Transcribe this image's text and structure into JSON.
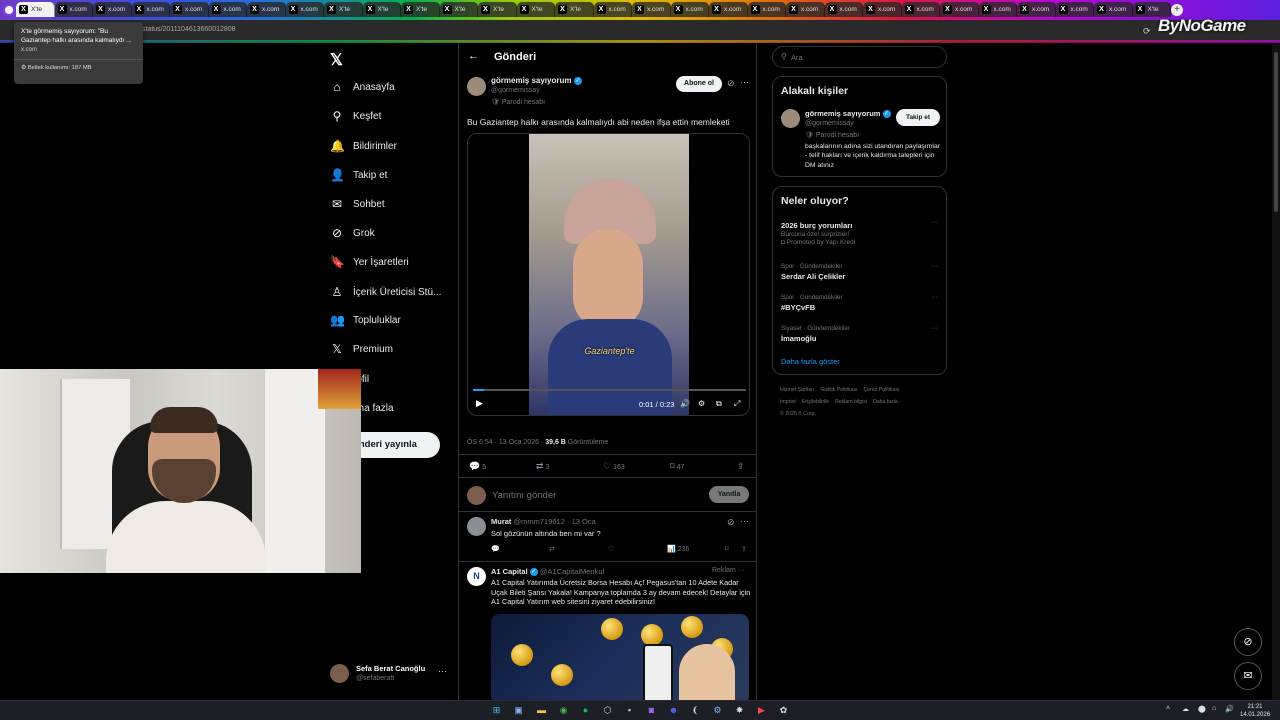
{
  "browser": {
    "tabs": [
      {
        "label": "X'te",
        "active": true
      },
      {
        "label": "x.com"
      },
      {
        "label": "x.com"
      },
      {
        "label": "x.com"
      },
      {
        "label": "x.com"
      },
      {
        "label": "x.com"
      },
      {
        "label": "x.com"
      },
      {
        "label": "x.com"
      },
      {
        "label": "X'te"
      },
      {
        "label": "X'te"
      },
      {
        "label": "X'te"
      },
      {
        "label": "X'te"
      },
      {
        "label": "X'te"
      },
      {
        "label": "X'te"
      },
      {
        "label": "X'te"
      },
      {
        "label": "x.com"
      },
      {
        "label": "x.com"
      },
      {
        "label": "x.com"
      },
      {
        "label": "x.com"
      },
      {
        "label": "x.com"
      },
      {
        "label": "x.com"
      },
      {
        "label": "x.com"
      },
      {
        "label": "x.com"
      },
      {
        "label": "x.com"
      },
      {
        "label": "x.com"
      },
      {
        "label": "x.com"
      },
      {
        "label": "x.com"
      },
      {
        "label": "x.com"
      },
      {
        "label": "x.com"
      },
      {
        "label": "X'te"
      }
    ],
    "url_fragment": "status/2011104613660012808",
    "brand": "ByNoGame",
    "tooltip": {
      "title": "X'te görmemiş sayıyorum: \"Bu Gaziantep halkı arasında kalmalıydı ...",
      "domain": "x.com",
      "memory": "Bellek kullanımı: 187 MB"
    }
  },
  "nav": {
    "items": [
      {
        "icon": "home-icon",
        "glyph": "⌂",
        "label": "Anasayfa"
      },
      {
        "icon": "search-icon",
        "glyph": "⚲",
        "label": "Keşfet"
      },
      {
        "icon": "bell-icon",
        "glyph": "🔔",
        "label": "Bildirimler"
      },
      {
        "icon": "follow-icon",
        "glyph": "👤",
        "label": "Takip et"
      },
      {
        "icon": "mail-icon",
        "glyph": "✉",
        "label": "Sohbet"
      },
      {
        "icon": "grok-icon",
        "glyph": "⊘",
        "label": "Grok"
      },
      {
        "icon": "bookmark-icon",
        "glyph": "🔖",
        "label": "Yer İşaretleri"
      },
      {
        "icon": "creator-icon",
        "glyph": "♙",
        "label": "İçerik Üreticisi Stü..."
      },
      {
        "icon": "communities-icon",
        "glyph": "👥",
        "label": "Topluluklar"
      },
      {
        "icon": "x-premium-icon",
        "glyph": "𝕏",
        "label": "Premium"
      },
      {
        "icon": "profile-icon",
        "glyph": "",
        "label": "rofil"
      },
      {
        "icon": "more-icon",
        "glyph": "",
        "label": "aha fazla"
      }
    ],
    "post_button": "önderi yayınla",
    "account": {
      "name": "Sefa Berat Canoğlu",
      "handle": "@sefaberatt"
    }
  },
  "header": {
    "title": "Gönderi"
  },
  "post": {
    "name": "görmemiş sayıyorum",
    "handle": "@gormemissay",
    "parody": "Parodi hesabı",
    "subscribe": "Abone ol",
    "text": "Bu Gaziantep halkı arasında kalmalıydı abi neden ifşa ettin memleketi",
    "video": {
      "caption": "Gaziantep'te",
      "time": "0:01 / 0:23",
      "progress": 0.04
    },
    "timestamp": "ÖS 6:54 · 13 Oca 2026 · ",
    "views": "39,6 B",
    "views_label": " Görüntüleme",
    "stats": {
      "replies": "5",
      "reposts": "3",
      "likes": "163",
      "bookmarks": "47"
    },
    "reply_placeholder": "Yanıtını gönder",
    "reply_button": "Yanıtla"
  },
  "comment": {
    "name": "Murat",
    "handle": "@mmm719612 · 13 Oca",
    "text": "Sol gözünün altında ben mi var ?",
    "views": "236"
  },
  "ad": {
    "name": "A1 Capital",
    "handle": "@A1CapitalMenkul",
    "label": "Reklam",
    "text": "A1 Capital Yatırımda Ücretsiz Borsa Hesabı Aç! Pegasus'tan 10 Adete Kadar Uçak Bileti Şansı Yakala! Kampanya toplamda 3 ay devam edecek! Detaylar için A1 Capital Yatırım web sitesini ziyaret edebilirsiniz!"
  },
  "right": {
    "search_placeholder": "Ara",
    "related_title": "Alakalı kişiler",
    "related": {
      "name": "görmemiş sayıyorum",
      "handle": "@gormemissay",
      "parody": "Parodi hesabı",
      "follow": "Takip et",
      "bio": "başkalarının adına sizi utandıran paylaşımlar - telif hakları ve içerik kaldırma talepleri için DM atınız"
    },
    "trends_title": "Neler oluyor?",
    "trends": [
      {
        "cat": "",
        "title": "2026 burç yorumları",
        "sub": "Burcuna özel sürprizler!",
        "promo": "Promoted by Yapı Kredi"
      },
      {
        "cat": "Spor · Gündemdekiler",
        "title": "Serdar Ali Çelikler"
      },
      {
        "cat": "Spor · Gündemdekiler",
        "title": "#BYÇvFB"
      },
      {
        "cat": "Siyaset · Gündemdekiler",
        "title": "İmamoğlu"
      }
    ],
    "show_more": "Daha fazla göster",
    "footer": [
      "Hizmet Şartları",
      "Gizlilik Politikası",
      "Çerez Politikası",
      "Imprint",
      "Erişilebilirlik",
      "Reklam bilgisi",
      "Daha fazla ···",
      "© 2026 X Corp."
    ]
  },
  "taskbar": {
    "time": "21:21",
    "date": "14.01.2026"
  }
}
